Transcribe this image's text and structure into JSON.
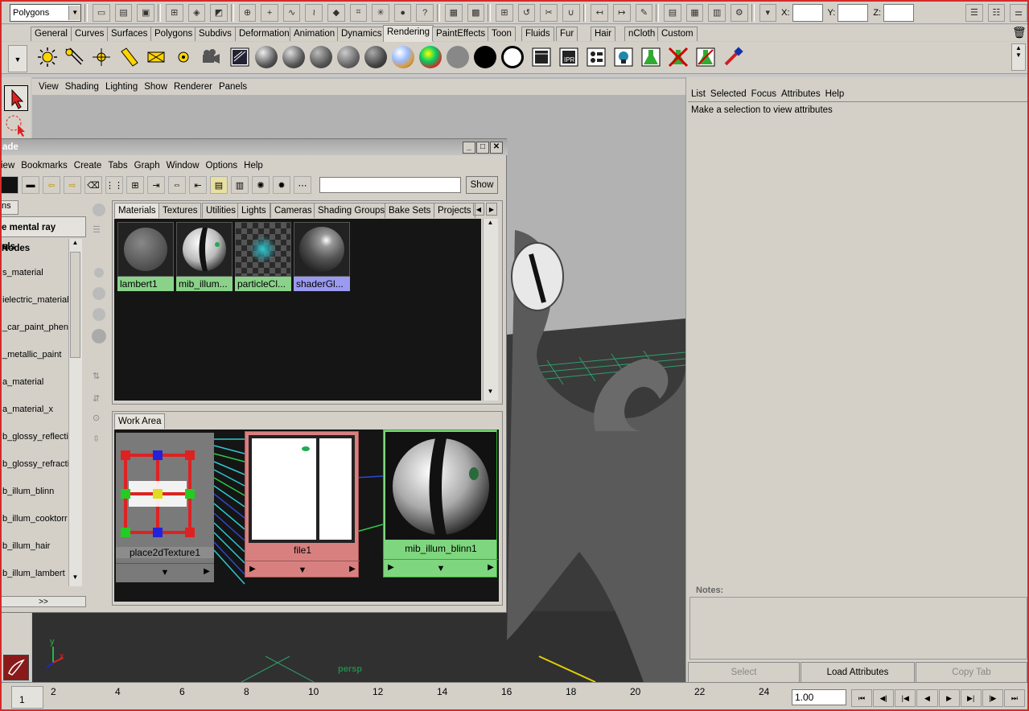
{
  "status_line": {
    "mode": "Polygons",
    "coord_labels": [
      "X:",
      "Y:",
      "Z:"
    ],
    "icons": [
      "new-scene-icon",
      "open-scene-icon",
      "save-scene-icon",
      "select-hierarchy-icon",
      "select-object-icon",
      "select-component-icon",
      "snap-grid-icon",
      "snap-curve-icon",
      "snap-point-icon",
      "snap-plane-icon",
      "make-live-icon",
      "history-icon",
      "lock-icon",
      "render-frame-icon",
      "ipr-render-icon",
      "render-settings-icon"
    ]
  },
  "shelf_tabs": [
    "General",
    "Curves",
    "Surfaces",
    "Polygons",
    "Subdivs",
    "Deformation",
    "Animation",
    "Dynamics",
    "Rendering",
    "PaintEffects",
    "Toon",
    "Fluids",
    "Fur",
    "Hair",
    "nCloth",
    "Custom"
  ],
  "active_shelf_tab": "Rendering",
  "viewport": {
    "menu": [
      "View",
      "Shading",
      "Lighting",
      "Show",
      "Renderer",
      "Panels"
    ],
    "camera_label": "persp",
    "axis_y": "y",
    "axis_x": "x"
  },
  "attribute_editor": {
    "menu": [
      "List",
      "Selected",
      "Focus",
      "Attributes",
      "Help"
    ],
    "message": "Make a selection to view attributes",
    "notes_label": "Notes:",
    "buttons": [
      "Select",
      "Load Attributes",
      "Copy Tab"
    ]
  },
  "hypershade": {
    "title": "ade",
    "menu": [
      "iew",
      "Bookmarks",
      "Create",
      "Tabs",
      "Graph",
      "Window",
      "Options",
      "Help"
    ],
    "show_button": "Show",
    "left_tab": "ns",
    "nodes_header": "e mental ray Nodes",
    "category": "als",
    "node_list": [
      "s_material",
      "ielectric_material",
      "_car_paint_phen",
      "_metallic_paint",
      "a_material",
      "a_material_x",
      "b_glossy_reflectio",
      "b_glossy_refractio",
      "b_illum_blinn",
      "b_illum_cooktorr",
      "b_illum_hair",
      "b_illum_lambert"
    ],
    "more_button": ">>",
    "tabs": [
      "Materials",
      "Textures",
      "Utilities",
      "Lights",
      "Cameras",
      "Shading Groups",
      "Bake Sets",
      "Projects"
    ],
    "materials": [
      {
        "name": "lambert1",
        "color": "#8ad28a"
      },
      {
        "name": "mib_illum...",
        "color": "#8ad28a"
      },
      {
        "name": "particleCl...",
        "color": "#8ad28a"
      },
      {
        "name": "shaderGl...",
        "color": "#9a9af0"
      }
    ],
    "work_area_tab": "Work Area",
    "work_nodes": [
      {
        "name": "place2dTexture1",
        "color": "#8c8c8c"
      },
      {
        "name": "file1",
        "color": "#d88080"
      },
      {
        "name": "mib_illum_blinn1",
        "color": "#7ed67e"
      }
    ]
  },
  "timeline": {
    "ticks": [
      "2",
      "4",
      "6",
      "8",
      "10",
      "12",
      "14",
      "16",
      "18",
      "20",
      "22",
      "24"
    ],
    "current_frame": "1",
    "frame_field": "1.00",
    "playback_icons": [
      "go-start-icon",
      "step-back-key-icon",
      "step-back-frame-icon",
      "play-back-icon",
      "play-forward-icon",
      "step-forward-frame-icon",
      "step-forward-key-icon",
      "go-end-icon"
    ],
    "playback_glyphs": [
      "⏮",
      "◀|",
      "|◀",
      "◀",
      "▶",
      "▶|",
      "|▶",
      "⏭"
    ]
  },
  "colors": {
    "frame_border": "#d42a2a",
    "panel_bg": "#d4d0c8",
    "swatch_bg": "#151515"
  }
}
